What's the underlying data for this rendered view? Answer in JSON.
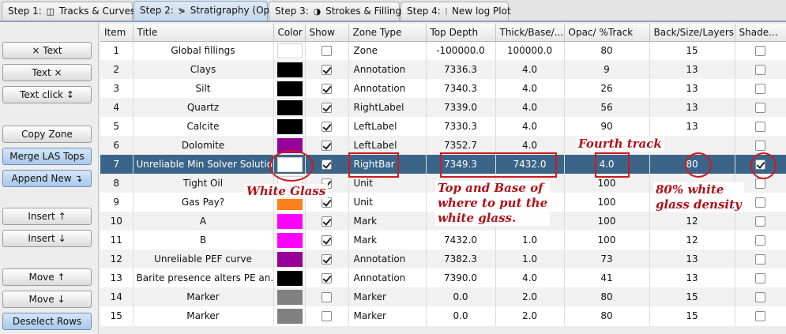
{
  "tabs": [
    {
      "label": "Step 1:",
      "icon": "◫",
      "rest": "Tracks & Curves",
      "active": false
    },
    {
      "label": "Step 2:",
      "icon": "⋟",
      "rest": "Stratigraphy (Opt.)",
      "active": true
    },
    {
      "label": "Step 3:",
      "icon": "◑",
      "rest": "Strokes & Fillings",
      "active": false
    },
    {
      "label": "Step 4:",
      "icon": "⦙",
      "rest": "New log Plot",
      "active": false
    }
  ],
  "left_buttons": {
    "text_x": "× Text",
    "text_x2": "Text ×",
    "text_click": "Text click ↕",
    "copy_zone": "Copy Zone",
    "merge_las_tops": "Merge LAS Tops",
    "append_new": "Append New ↴",
    "insert_up": "Insert ↑",
    "insert_down": "Insert ↓",
    "move_up": "Move ↑",
    "move_down": "Move ↓",
    "deselect_rows": "Deselect Rows"
  },
  "table": {
    "columns": [
      "Item",
      "Title",
      "Color",
      "Show",
      "Zone Type",
      "Top Depth",
      "Thick/Base/...",
      "Opac/ %Track",
      "Back/Size/Layers",
      "Shade..."
    ],
    "rows": [
      {
        "item": "1",
        "title": "Global fillings",
        "color": "#ffffff",
        "show": false,
        "zone": "Zone",
        "top": "-100000.0",
        "thick": "100000.0",
        "opac": "80",
        "back": "15",
        "shade": false
      },
      {
        "item": "2",
        "title": "Clays",
        "color": "#000000",
        "show": true,
        "zone": "Annotation",
        "top": "7336.3",
        "thick": "4.0",
        "opac": "9",
        "back": "13",
        "shade": false
      },
      {
        "item": "3",
        "title": "Silt",
        "color": "#000000",
        "show": true,
        "zone": "Annotation",
        "top": "7340.3",
        "thick": "4.0",
        "opac": "26",
        "back": "13",
        "shade": false
      },
      {
        "item": "4",
        "title": "Quartz",
        "color": "#000000",
        "show": true,
        "zone": "RightLabel",
        "top": "7339.0",
        "thick": "4.0",
        "opac": "56",
        "back": "13",
        "shade": false
      },
      {
        "item": "5",
        "title": "Calcite",
        "color": "#000000",
        "show": true,
        "zone": "LeftLabel",
        "top": "7330.3",
        "thick": "4.0",
        "opac": "90",
        "back": "13",
        "shade": false
      },
      {
        "item": "6",
        "title": "Dolomite",
        "color": "#990099",
        "show": true,
        "zone": "LeftLabel",
        "top": "7352.7",
        "thick": "4.0",
        "opac": "",
        "back": "",
        "shade": false
      },
      {
        "item": "7",
        "title": "Unreliable Min Solver Solution",
        "color": "#ffffff",
        "show": true,
        "zone": "RightBar",
        "top": "7349.3",
        "thick": "7432.0",
        "opac": "4.0",
        "back": "80",
        "shade": true,
        "selected": true
      },
      {
        "item": "8",
        "title": "Tight Oil",
        "color": "#ffffff",
        "show": true,
        "zone": "Unit",
        "top": "",
        "thick": "",
        "opac": "100",
        "back": "",
        "shade": false
      },
      {
        "item": "9",
        "title": "Gas Pay?",
        "color": "#ff7f1a",
        "show": true,
        "zone": "Unit",
        "top": "",
        "thick": "",
        "opac": "100",
        "back": "",
        "shade": false
      },
      {
        "item": "10",
        "title": "A",
        "color": "#ff00ff",
        "show": true,
        "zone": "Mark",
        "top": "",
        "thick": "",
        "opac": "100",
        "back": "12",
        "shade": false
      },
      {
        "item": "11",
        "title": "B",
        "color": "#ff00ff",
        "show": true,
        "zone": "Mark",
        "top": "7432.0",
        "thick": "1.0",
        "opac": "100",
        "back": "12",
        "shade": false
      },
      {
        "item": "12",
        "title": "Unreliable PEF curve",
        "color": "#990099",
        "show": true,
        "zone": "Annotation",
        "top": "7382.3",
        "thick": "1.0",
        "opac": "73",
        "back": "13",
        "shade": false
      },
      {
        "item": "13",
        "title": "Barite presence alters PE an...",
        "color": "#000000",
        "show": true,
        "zone": "Annotation",
        "top": "7390.0",
        "thick": "4.0",
        "opac": "41",
        "back": "13",
        "shade": false
      },
      {
        "item": "14",
        "title": "Marker",
        "color": "#808080",
        "show": false,
        "zone": "Marker",
        "top": "0.0",
        "thick": "2.0",
        "opac": "80",
        "back": "15",
        "shade": false
      },
      {
        "item": "15",
        "title": "Marker",
        "color": "#808080",
        "show": false,
        "zone": "Marker",
        "top": "0.0",
        "thick": "2.0",
        "opac": "80",
        "back": "15",
        "shade": false
      }
    ]
  },
  "annotations": {
    "white_glass": "White Glass",
    "fourth_track": "Fourth track",
    "top_base": "Top and Base of\nwhere to put the\nwhite glass.",
    "density": "80% white\nglass density"
  }
}
